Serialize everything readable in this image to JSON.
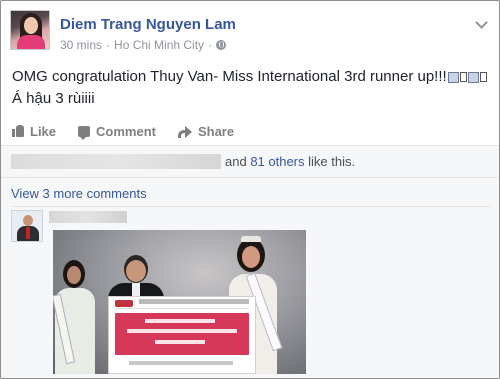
{
  "post": {
    "author": "Diem Trang Nguyen Lam",
    "time": "30 mins",
    "separator": "·",
    "location": "Ho Chi Minh City",
    "separator2": "·",
    "text_line1": "OMG congratulation Thuy Van- Miss International 3rd runner up!!!",
    "text_line2": "Á hậu 3 rùiiii"
  },
  "actions": {
    "like": "Like",
    "comment": "Comment",
    "share": "Share"
  },
  "feedback": {
    "likes_prefix": "and ",
    "others_link": "81 others",
    "likes_suffix": " like this.",
    "view_more": "View 3 more comments"
  },
  "icons": {
    "privacy": "globe-icon",
    "options": "chevron-down-icon"
  },
  "colors": {
    "link": "#365899",
    "muted": "#90949c"
  }
}
